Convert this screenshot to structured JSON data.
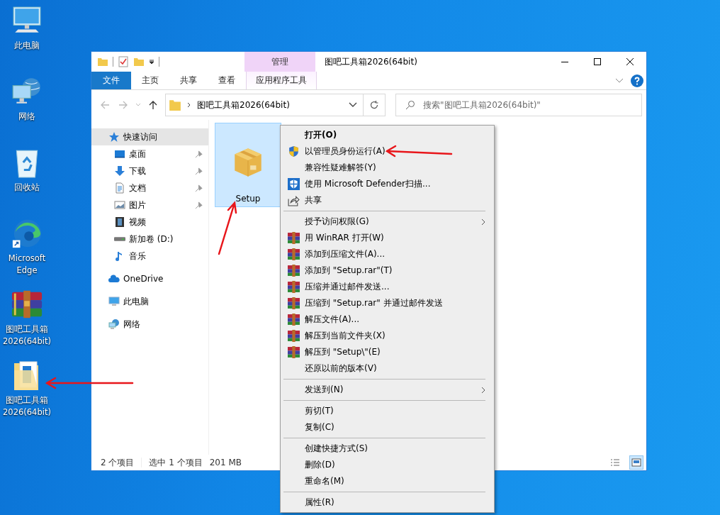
{
  "desktop_icons": [
    {
      "label": "此电脑",
      "kind": "computer"
    },
    {
      "label": "网络",
      "kind": "network"
    },
    {
      "label": "回收站",
      "kind": "recycle"
    },
    {
      "label": "Microsoft Edge",
      "kind": "edge"
    },
    {
      "label": "图吧工具箱2026(64bit)",
      "kind": "archive"
    },
    {
      "label": "图吧工具箱2026(64bit)",
      "kind": "folder"
    }
  ],
  "window": {
    "title": "图吧工具箱2026(64bit)",
    "context_tab_header": "管理",
    "ribbon_tabs": [
      {
        "label": "文件",
        "kind": "file"
      },
      {
        "label": "主页",
        "kind": "normal"
      },
      {
        "label": "共享",
        "kind": "normal"
      },
      {
        "label": "查看",
        "kind": "normal"
      },
      {
        "label": "应用程序工具",
        "kind": "contextual"
      }
    ],
    "address": {
      "path": "图吧工具箱2026(64bit)"
    },
    "search": {
      "placeholder": "搜索\"图吧工具箱2026(64bit)\""
    },
    "nav": [
      {
        "label": "快速访问",
        "kind": "star",
        "selected": true,
        "children": [
          {
            "label": "桌面",
            "kind": "desktop",
            "pinned": true,
            "selected": false
          },
          {
            "label": "下载",
            "kind": "download",
            "pinned": true,
            "selected": false
          },
          {
            "label": "文档",
            "kind": "document",
            "pinned": true,
            "selected": false
          },
          {
            "label": "图片",
            "kind": "picture",
            "pinned": true,
            "selected": false
          },
          {
            "label": "视频",
            "kind": "video",
            "pinned": false,
            "selected": false
          },
          {
            "label": "新加卷 (D:)",
            "kind": "drive",
            "pinned": false,
            "selected": false
          },
          {
            "label": "音乐",
            "kind": "music",
            "pinned": false,
            "selected": false
          }
        ]
      },
      {
        "label": "OneDrive",
        "kind": "cloud",
        "selected": false
      },
      {
        "label": "此电脑",
        "kind": "computer",
        "selected": false
      },
      {
        "label": "网络",
        "kind": "network",
        "selected": false
      }
    ],
    "files": [
      {
        "name": "Setup",
        "selected": true
      }
    ],
    "status": {
      "count": "2 个项目",
      "selection": "选中 1 个项目",
      "size": "201 MB"
    },
    "views": [
      {
        "kind": "details",
        "selected": false
      },
      {
        "kind": "large-icons",
        "selected": true
      }
    ]
  },
  "context_menu": [
    {
      "kind": "default",
      "label": "打开(O)"
    },
    {
      "kind": "admin",
      "label": "以管理员身份运行(A)"
    },
    {
      "kind": "item",
      "label": "兼容性疑难解答(Y)"
    },
    {
      "kind": "scan",
      "label": "使用 Microsoft Defender扫描..."
    },
    {
      "kind": "share",
      "label": "共享"
    },
    {
      "kind": "separator"
    },
    {
      "kind": "submenu",
      "label": "授予访问权限(G)"
    },
    {
      "kind": "archive",
      "label": "用 WinRAR 打开(W)"
    },
    {
      "kind": "archive",
      "label": "添加到压缩文件(A)..."
    },
    {
      "kind": "archive",
      "label": "添加到 \"Setup.rar\"(T)"
    },
    {
      "kind": "archive",
      "label": "压缩并通过邮件发送..."
    },
    {
      "kind": "archive",
      "label": "压缩到 \"Setup.rar\" 并通过邮件发送"
    },
    {
      "kind": "archive",
      "label": "解压文件(A)..."
    },
    {
      "kind": "archive",
      "label": "解压到当前文件夹(X)"
    },
    {
      "kind": "archive",
      "label": "解压到 \"Setup\\\"(E)"
    },
    {
      "kind": "item",
      "label": "还原以前的版本(V)"
    },
    {
      "kind": "separator"
    },
    {
      "kind": "submenu",
      "label": "发送到(N)"
    },
    {
      "kind": "separator"
    },
    {
      "kind": "item",
      "label": "剪切(T)"
    },
    {
      "kind": "item",
      "label": "复制(C)"
    },
    {
      "kind": "separator"
    },
    {
      "kind": "item",
      "label": "创建快捷方式(S)"
    },
    {
      "kind": "item",
      "label": "删除(D)"
    },
    {
      "kind": "item",
      "label": "重命名(M)"
    },
    {
      "kind": "separator"
    },
    {
      "kind": "item",
      "label": "属性(R)"
    }
  ]
}
